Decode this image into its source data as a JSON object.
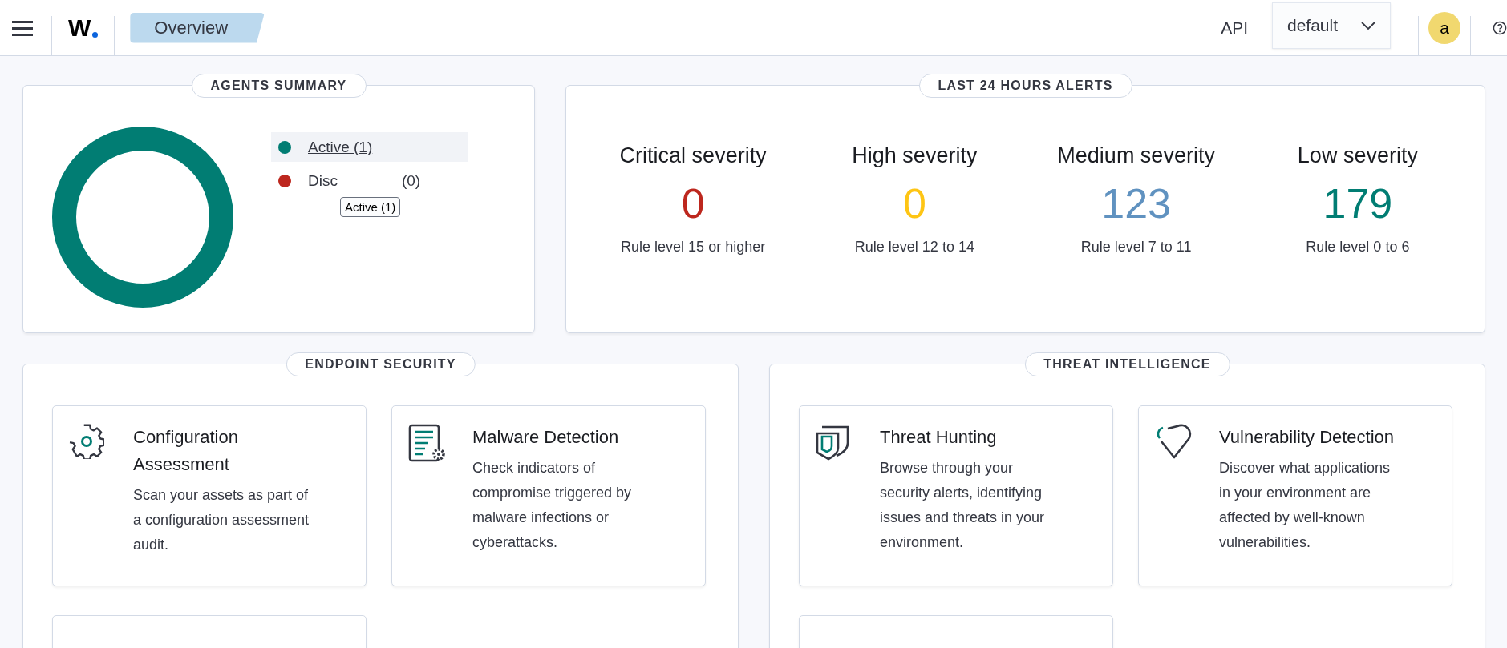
{
  "header": {
    "logo_text": "W",
    "breadcrumb": "Overview",
    "api_link": "API",
    "space_select": {
      "value": "default"
    },
    "avatar": "a"
  },
  "agents_summary": {
    "title": "AGENTS SUMMARY",
    "legend": [
      {
        "label": "Active (1)",
        "color": "#017d73",
        "selected": true
      },
      {
        "label": "Disc",
        "label_after": "(0)",
        "color": "#bd271e",
        "selected": false
      }
    ],
    "tooltip": "Active (1)"
  },
  "alerts": {
    "title": "LAST 24 HOURS ALERTS",
    "items": [
      {
        "title": "Critical severity",
        "value": "0",
        "color": "#bd271e",
        "caption": "Rule level 15 or higher"
      },
      {
        "title": "High severity",
        "value": "0",
        "color": "#fec514",
        "caption": "Rule level 12 to 14"
      },
      {
        "title": "Medium severity",
        "value": "123",
        "color": "#6092c0",
        "caption": "Rule level 7 to 11"
      },
      {
        "title": "Low severity",
        "value": "179",
        "color": "#017d73",
        "caption": "Rule level 0 to 6"
      }
    ]
  },
  "sections": [
    {
      "title": "ENDPOINT SECURITY",
      "cards": [
        {
          "kind": "module",
          "title": "Configuration Assessment",
          "description": "Scan your assets as part of a configuration assessment audit."
        },
        {
          "kind": "module",
          "title": "Malware Detection",
          "description": "Check indicators of compromise triggered by malware infections or cyberattacks."
        },
        {
          "kind": "cut"
        }
      ]
    },
    {
      "title": "THREAT INTELLIGENCE",
      "cards": [
        {
          "kind": "module",
          "title": "Threat Hunting",
          "description": "Browse through your security alerts, identifying issues and threats in your environment."
        },
        {
          "kind": "module",
          "title": "Vulnerability Detection",
          "description": "Discover what applications in your environment are affected by well-known vulnerabilities."
        },
        {
          "kind": "cut"
        }
      ]
    }
  ]
}
